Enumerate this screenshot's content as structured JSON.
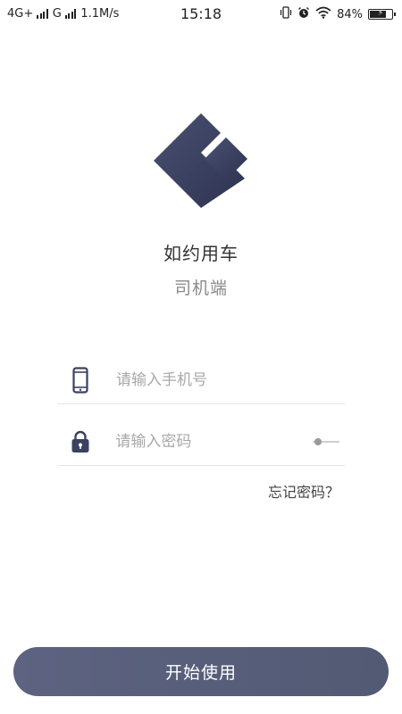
{
  "status_bar": {
    "network1": "4G+",
    "network2": "G",
    "speed": "1.1M/s",
    "time": "15:18",
    "battery": "84%",
    "battery_level": 0.84
  },
  "app": {
    "name": "如约用车",
    "subtitle": "司机端"
  },
  "form": {
    "phone_placeholder": "请输入手机号",
    "password_placeholder": "请输入密码",
    "forgot_password": "忘记密码？"
  },
  "actions": {
    "start_label": "开始使用"
  },
  "colors": {
    "brand": "#3b4160",
    "brand_dark": "#2d3350",
    "button": "#5a6079",
    "icon": "#3b4160"
  },
  "icons": [
    "vibrate-icon",
    "alarm-icon",
    "wifi-icon",
    "battery-icon",
    "phone-icon",
    "lock-icon",
    "password-visibility-toggle"
  ]
}
